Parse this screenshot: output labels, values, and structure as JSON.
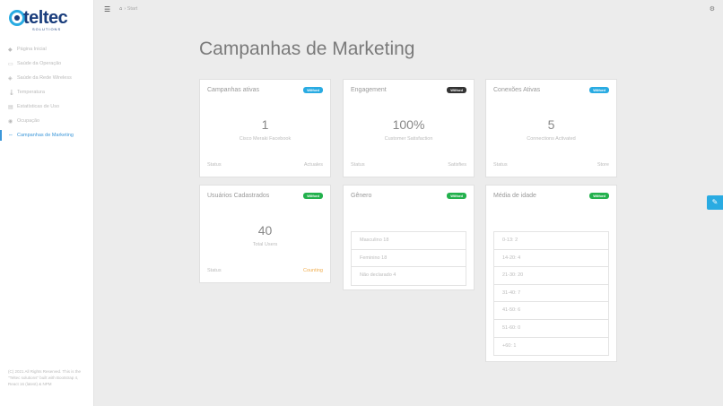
{
  "brand": {
    "name": "teltec",
    "sub": "SOLUTIONS"
  },
  "breadcrumb": {
    "current": "Start"
  },
  "sidebar": {
    "items": [
      {
        "icon": "◆",
        "label": "Página Inicial"
      },
      {
        "icon": "▭",
        "label": "Saúde da Operação"
      },
      {
        "icon": "◈",
        "label": "Saúde da Rede Wireless"
      },
      {
        "icon": "🌡",
        "label": "Temperatura"
      },
      {
        "icon": "▤",
        "label": "Estatísticas de Uso"
      },
      {
        "icon": "◉",
        "label": "Ocupação"
      },
      {
        "icon": "⇔",
        "label": "Campanhas de Marketing"
      }
    ],
    "footer": "(C) 2021 All Rights Reserved. This is the \"Teltec solutions\" built with Bootstrap 4, React 16 (latest) & NPM"
  },
  "page": {
    "title": "Campanhas de Marketing"
  },
  "cards": [
    {
      "title": "Campanhas ativas",
      "badge": "Wilford",
      "value": "1",
      "desc": "Cisco Meraki Facebook",
      "status_label": "Status",
      "status_value": "Actuales"
    },
    {
      "title": "Engagement",
      "badge": "Wilford",
      "value": "100%",
      "desc": "Customer Satisfaction",
      "status_label": "Status",
      "status_value": "Satisfies"
    },
    {
      "title": "Conexões Ativas",
      "badge": "Wilford",
      "value": "5",
      "desc": "Connections Activated",
      "status_label": "Status",
      "status_value": "Store"
    },
    {
      "title": "Usuários Cadastrados",
      "badge": "Wilford",
      "value": "40",
      "desc": "Total Users",
      "status_label": "Status",
      "status_value": "Counting"
    }
  ],
  "genero": {
    "title": "Gênero",
    "badge": "Wilford",
    "items": [
      "Masculino 18",
      "Feminino 18",
      "Não declarado 4"
    ]
  },
  "idade": {
    "title": "Média de idade",
    "badge": "Wilford",
    "items": [
      "0-13: 2",
      "14-20: 4",
      "21-30: 20",
      "31-40: 7",
      "41-50: 6",
      "51-60: 0",
      "+60: 1"
    ]
  },
  "colors": {
    "accent": "#29abe2",
    "dark_badge": "#333333",
    "green_badge": "#23b14d",
    "warning": "#f0ad4e"
  },
  "icons": {
    "menu": "menu-icon",
    "home": "home-icon",
    "settings": "gear-icon",
    "edit": "pencil-icon"
  }
}
